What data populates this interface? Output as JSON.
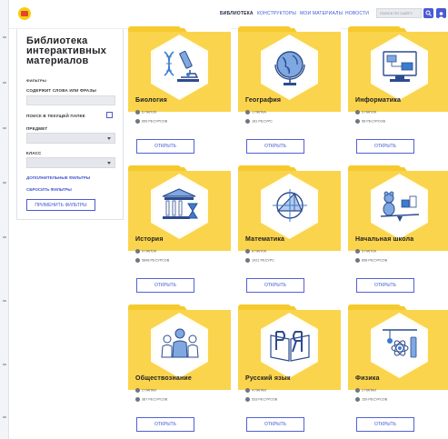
{
  "nav": {
    "library": "БИБЛИОТЕКА",
    "constructors": "КОНСТРУКТОРЫ",
    "my_materials": "МОИ МАТЕРИАЛЫ",
    "news": "НОВОСТИ",
    "search_placeholder": "ПОИСК ПО САЙТУ"
  },
  "filters": {
    "title_line1": "Библиотека",
    "title_line2": "интерактивных",
    "title_line3": "материалов",
    "section_label": "ФИЛЬТРЫ",
    "contains_label": "СОДЕРЖИТ СЛОВА ИЛИ ФРАЗЫ",
    "search_in_folder_label": "ПОИСК В ТЕКУЩЕЙ ПАПКЕ",
    "subject_label": "ПРЕДМЕТ",
    "grade_label": "КЛАСС",
    "more_filters": "ДОПОЛНИТЕЛЬНЫЕ ФИЛЬТРЫ",
    "reset_filters": "СБРОСИТЬ ФИЛЬТРЫ",
    "apply_button": "ПРИМЕНИТЬ ФИЛЬТРЫ"
  },
  "subjects": [
    {
      "title": "Биология",
      "folders": "6 ПАПОК",
      "resources": "659 РЕСУРСОВ",
      "button": "ОТКРЫТЬ",
      "icon": "biology-icon"
    },
    {
      "title": "География",
      "folders": "1 ПАПКА",
      "resources": "181 РЕСУРС",
      "button": "ОТКРЫТЬ",
      "icon": "geography-icon"
    },
    {
      "title": "Информатика",
      "folders": "5 ПАПОК",
      "resources": "58 РЕСУРСОВ",
      "button": "ОТКРЫТЬ",
      "icon": "informatics-icon"
    },
    {
      "title": "История",
      "folders": "9 ПАПОК",
      "resources": "5848 РЕСУРСОВ",
      "button": "ОТКРЫТЬ",
      "icon": "history-icon"
    },
    {
      "title": "Математика",
      "folders": "8 ПАПОК",
      "resources": "1021 РЕСУРС",
      "button": "ОТКРЫТЬ",
      "icon": "math-icon"
    },
    {
      "title": "Начальная школа",
      "folders": "5 ПАПОК",
      "resources": "858 РЕСУРСОВ",
      "button": "ОТКРЫТЬ",
      "icon": "primary-school-icon"
    },
    {
      "title": "Обществознание",
      "folders": "2 ПАПКИ",
      "resources": "387 РЕСУРСОВ",
      "button": "ОТКРЫТЬ",
      "icon": "social-studies-icon"
    },
    {
      "title": "Русский язык",
      "folders": "4 ПАПКИ",
      "resources": "533 РЕСУРСОВ",
      "button": "ОТКРЫТЬ",
      "icon": "russian-language-icon"
    },
    {
      "title": "Физика",
      "folders": "2 ПАПКИ",
      "resources": "159 РЕСУРСОВ",
      "button": "ОТКРЫТЬ",
      "icon": "physics-icon"
    }
  ],
  "colors": {
    "accent": "#4a5ad4",
    "folder": "#fad44c",
    "logo": "#f6cf0c"
  }
}
